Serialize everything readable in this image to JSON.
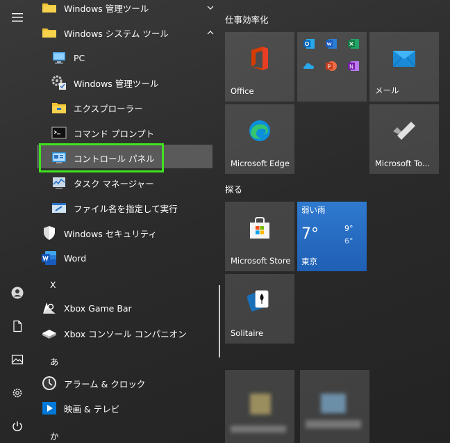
{
  "rail": {
    "items": [
      {
        "icon": "hamburger-menu-icon"
      },
      {
        "icon": "user-account-icon"
      },
      {
        "icon": "documents-icon"
      },
      {
        "icon": "pictures-icon"
      },
      {
        "icon": "settings-gear-icon"
      },
      {
        "icon": "power-icon"
      }
    ]
  },
  "applist": {
    "folder_admin_tools": "Windows 管理ツール",
    "folder_system_tools": "Windows システム ツール",
    "sub_items": [
      {
        "label": "PC",
        "icon": "pc-icon"
      },
      {
        "label": "Windows 管理ツール",
        "icon": "admin-tools-icon"
      },
      {
        "label": "エクスプローラー",
        "icon": "file-explorer-icon"
      },
      {
        "label": "コマンド プロンプト",
        "icon": "command-prompt-icon"
      },
      {
        "label": "コントロール パネル",
        "icon": "control-panel-icon"
      },
      {
        "label": "タスク マネージャー",
        "icon": "task-manager-icon"
      },
      {
        "label": "ファイル名を指定して実行",
        "icon": "run-icon"
      }
    ],
    "security": "Windows セキュリティ",
    "word": "Word",
    "letter_x": "X",
    "xbox_gamebar": "Xbox Game Bar",
    "xbox_companion": "Xbox コンソール コンパニオン",
    "letter_a": "あ",
    "alarm_clock": "アラーム & クロック",
    "movies_tv": "映画 & テレビ",
    "letter_ka": "か"
  },
  "tiles": {
    "group_productivity": "仕事効率化",
    "group_explore": "探る",
    "office": "Office",
    "mail": "メール",
    "edge": "Microsoft Edge",
    "todo": "Microsoft To...",
    "store": "Microsoft Store",
    "weather_title": "弱い雨",
    "weather_temp": "7°",
    "weather_high": "9°",
    "weather_low": "6°",
    "weather_city": "東京",
    "solitaire": "Solitaire"
  },
  "colors": {
    "highlight_box": "#3fe31e",
    "office_red": "#d83b01",
    "weather_blue": "#2a72c8"
  }
}
